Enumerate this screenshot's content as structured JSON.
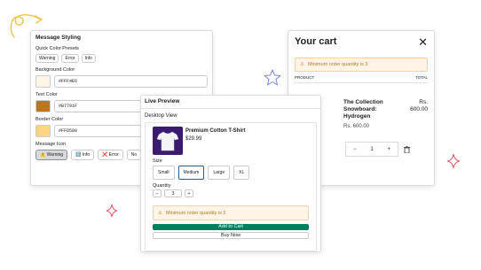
{
  "styling": {
    "title": "Message Styling",
    "presets_label": "Quick Color Presets",
    "presets": [
      "Warning",
      "Error",
      "Info"
    ],
    "background_label": "Background Color",
    "background_value": "#FFF4E6",
    "text_label": "Text Color",
    "text_value": "#B7791F",
    "border_label": "Border Color",
    "border_value": "#FFD580",
    "icon_label": "Message Icon",
    "icons": [
      {
        "glyph": "⚠️",
        "label": "Warning"
      },
      {
        "glyph": "ℹ️",
        "label": "Info"
      },
      {
        "glyph": "❌",
        "label": "Error"
      },
      {
        "glyph": "",
        "label": "No"
      }
    ]
  },
  "cart": {
    "title": "Your cart",
    "warning_text": "Minimum order quantity is 3",
    "col_product": "PRODUCT",
    "col_total": "TOTAL",
    "item_name": "The Collection Snowboard: Hydrogen",
    "item_price": "Rs. 600.00",
    "item_total": "Rs. 600.00",
    "qty": "1",
    "minus": "−",
    "plus": "+"
  },
  "preview": {
    "title": "Live Preview",
    "view": "Desktop View",
    "product_name": "Premium Cotton T-Shirt",
    "product_price": "$29.99",
    "size_label": "Size",
    "sizes": [
      "Small",
      "Medium",
      "Large",
      "XL"
    ],
    "qty_label": "Quantity",
    "qty_minus": "−",
    "qty_value": "3",
    "qty_plus": "+",
    "warning_text": "Minimum order quantity is 2",
    "add_to_cart": "Add to Cart",
    "buy_now": "Buy Now"
  },
  "colors": {
    "warning_bg": "#FFF4E6",
    "warning_text": "#B7791F",
    "warning_border": "#FFD580",
    "accent_green": "#008060",
    "selected_border": "#1F5F9F",
    "sparkle": "#e05a6a",
    "arrow": "#f0c34a"
  },
  "icons": {
    "warning": "warning-icon",
    "close": "close-icon",
    "trash": "trash-icon"
  }
}
